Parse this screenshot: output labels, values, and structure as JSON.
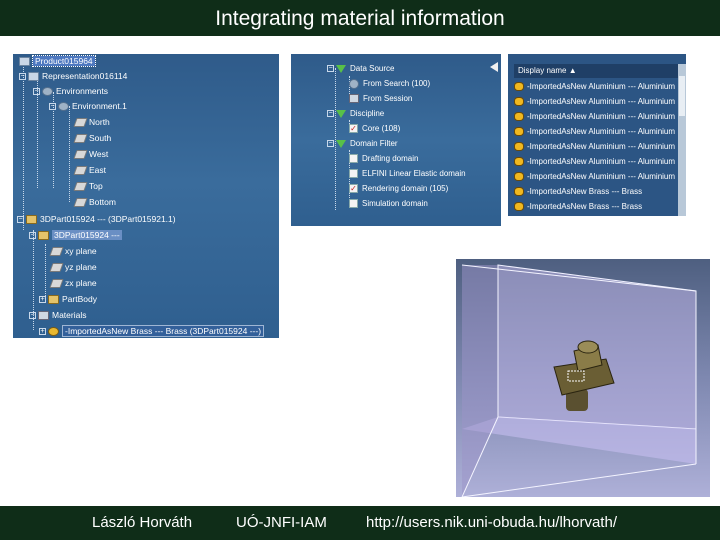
{
  "slide": {
    "title": "Integrating material information"
  },
  "footer": {
    "author": "László Horváth",
    "institute": "UÓ-JNFI-IAM",
    "url": "http://users.nik.uni-obuda.hu/lhorvath/"
  },
  "spec_tree": {
    "root": "Product015964",
    "representation": "Representation016114",
    "environments": "Environments",
    "environment": "Environment.1",
    "directions": [
      "North",
      "South",
      "West",
      "East",
      "Top",
      "Bottom"
    ],
    "part_instance": "3DPart015924 --- (3DPart015921.1)",
    "part": "3DPart015924 ---",
    "planes": [
      "xy plane",
      "yz plane",
      "zx plane"
    ],
    "partbody": "PartBody",
    "materials": "Materials",
    "material_item": "-ImportedAsNew Brass --- Brass (3DPart015924 ---)"
  },
  "filter": {
    "data_source": "Data Source",
    "from_search": "From Search (100)",
    "from_session": "From Session",
    "discipline": "Discipline",
    "core": "Core (108)",
    "domain_filter": "Domain Filter",
    "domains": [
      {
        "label": "Drafting domain",
        "checked": false
      },
      {
        "label": "ELFINI Linear Elastic domain",
        "checked": false
      },
      {
        "label": "Rendering domain (105)",
        "checked": true
      },
      {
        "label": "Simulation domain",
        "checked": false
      }
    ]
  },
  "results": {
    "header": "Display name ▲",
    "rows": [
      "-ImportedAsNew Aluminium --- Aluminium",
      "-ImportedAsNew Aluminium --- Aluminium",
      "-ImportedAsNew Aluminium --- Aluminium",
      "-ImportedAsNew Aluminium --- Aluminium",
      "-ImportedAsNew Aluminium --- Aluminium",
      "-ImportedAsNew Aluminium --- Aluminium",
      "-ImportedAsNew Aluminium --- Aluminium",
      "-ImportedAsNew Brass --- Brass",
      "-ImportedAsNew Brass --- Brass"
    ]
  },
  "colors": {
    "bar": "#0f2d18",
    "panel_blue": "#2f5b8a",
    "box_face": "#c8c0ec"
  }
}
